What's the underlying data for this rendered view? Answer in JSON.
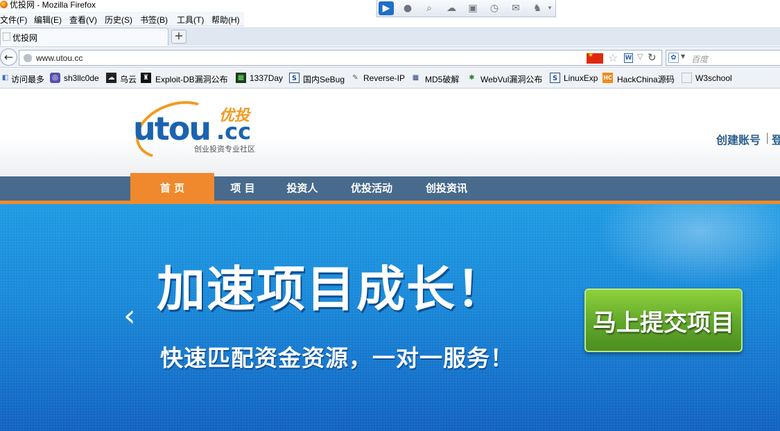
{
  "window": {
    "title": "优投网 - Mozilla Firefox"
  },
  "menu": [
    {
      "label": "文件(F)"
    },
    {
      "label": "编辑(E)"
    },
    {
      "label": "查看(V)"
    },
    {
      "label": "历史(S)"
    },
    {
      "label": "书签(B)"
    },
    {
      "label": "工具(T)"
    },
    {
      "label": "帮助(H)"
    }
  ],
  "tabs": [
    {
      "label": "优投网"
    }
  ],
  "new_tab_symbol": "+",
  "urlbar": {
    "url": "www.utou.cc"
  },
  "search": {
    "placeholder": "百度"
  },
  "bookmarks": [
    {
      "label": "访问最多",
      "icon": "blue-bookmark-icon"
    },
    {
      "label": "sh3llc0de",
      "icon": "target-icon"
    },
    {
      "label": "乌云",
      "icon": "cloud-icon"
    },
    {
      "label": "Exploit-DB漏洞公布",
      "icon": "robot-icon"
    },
    {
      "label": "1337Day",
      "icon": "green-chip-icon"
    },
    {
      "label": "国内SeBug",
      "icon": "s-icon"
    },
    {
      "label": "Reverse-IP",
      "icon": "wrench-icon"
    },
    {
      "label": "MD5破解",
      "icon": "grid-icon"
    },
    {
      "label": "WebVul漏洞公布",
      "icon": "bug-icon"
    },
    {
      "label": "LinuxExp",
      "icon": "s-icon"
    },
    {
      "label": "HackChina源码",
      "icon": "hc-icon"
    },
    {
      "label": "W3school",
      "icon": "dotted-page-icon"
    }
  ],
  "site": {
    "logo_text": "utou",
    "logo_suffix": ".cc",
    "logo_badge": "优投",
    "logo_tagline": "创业投资专业社区",
    "register_label": "创建账号",
    "separator": "|",
    "login_partial": "登"
  },
  "nav": [
    {
      "label": "首 页",
      "active": true
    },
    {
      "label": "项 目",
      "active": false
    },
    {
      "label": "投资人",
      "active": false
    },
    {
      "label": "优投活动",
      "active": false
    },
    {
      "label": "创投资讯",
      "active": false
    }
  ],
  "banner": {
    "headline": "加速项目成长！",
    "subline": "快速匹配资金资源，一对一服务！",
    "cta_label": "马上提交项目",
    "prev_symbol": "‹"
  },
  "colors": {
    "nav_bg": "#486a8c",
    "nav_active": "#f0892d",
    "banner_top": "#1f9be3",
    "banner_bottom": "#1363c1",
    "cta_green": "#5fa72a",
    "logo_blue": "#1b63b0",
    "logo_orange": "#f39a1f"
  }
}
